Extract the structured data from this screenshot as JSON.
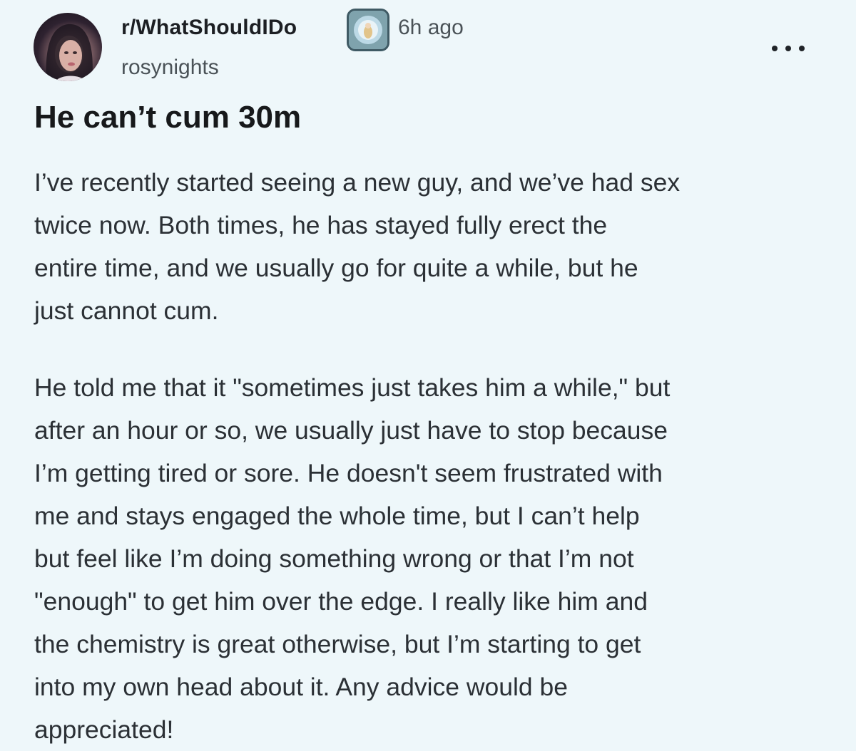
{
  "post": {
    "subreddit": "r/WhatShouldIDo",
    "timestamp": "6h ago",
    "username": "rosynights",
    "title": "He can’t cum 30m",
    "paragraph1": [
      "I’ve recently started seeing a new guy, and we’ve had sex",
      "twice now. Both times, he has stayed fully erect the",
      "entire time, and we usually go for quite a while, but he",
      "just cannot cum."
    ],
    "paragraph2": [
      "He told me that it \"sometimes just takes him a while,\" but",
      "after an hour or so, we usually just have to stop because",
      "I’m getting tired or sore. He doesn't seem frustrated with",
      "me and stays engaged the whole time, but I can’t help",
      "but feel like I’m doing something wrong or that I’m not",
      "\"enough\" to get him over the edge. I really like him and",
      "the chemistry is great otherwise, but I’m starting to get",
      "into my own head about it. Any advice would be",
      "appreciated!"
    ]
  },
  "icons": {
    "avatar": "user-avatar",
    "subreddit_icon": "subreddit-icon",
    "more": "more-options-icon"
  },
  "colors": {
    "background": "#eef7fa",
    "text": "#2b3035",
    "muted": "#4a5257"
  }
}
